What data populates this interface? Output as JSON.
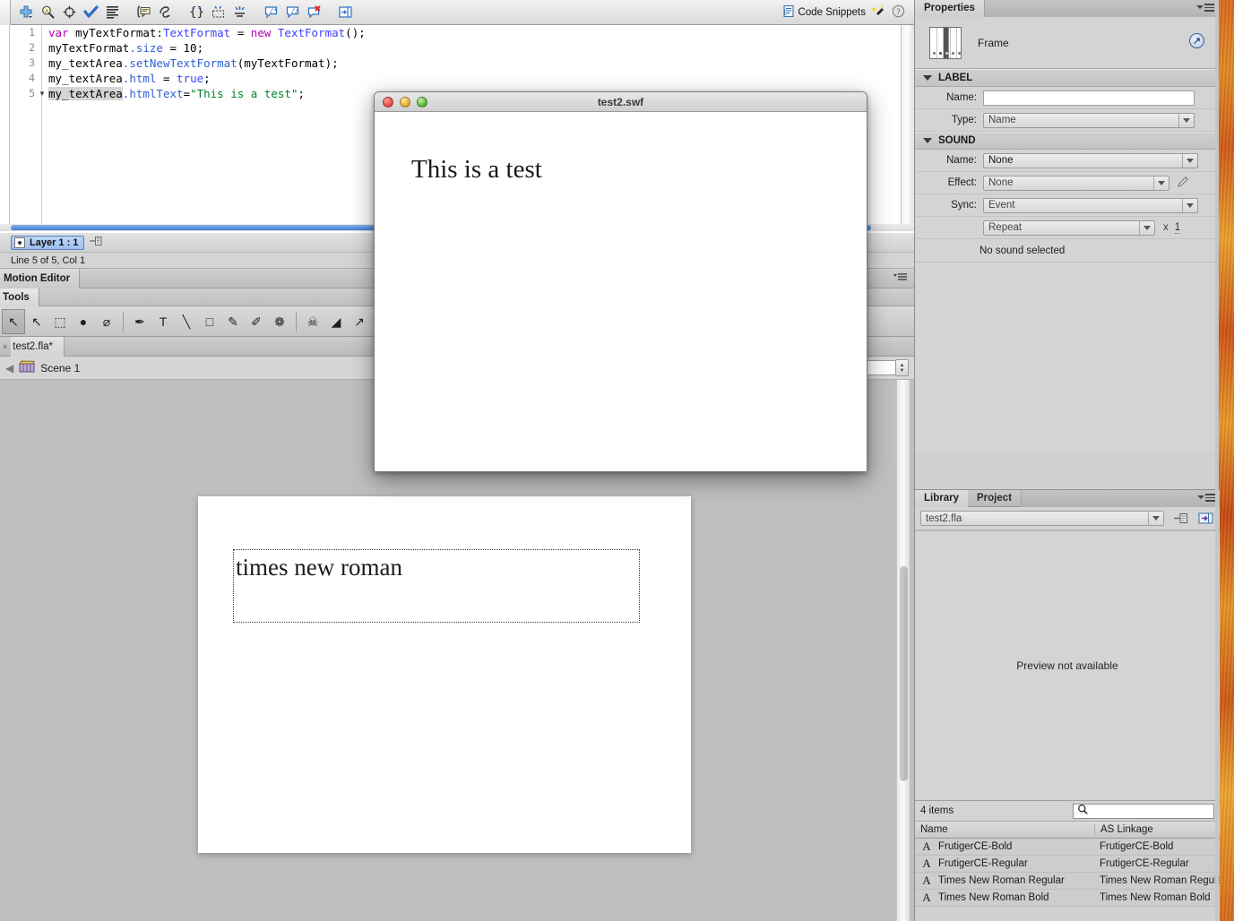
{
  "actions_toolbar": {
    "icons": [
      {
        "name": "add-item-icon",
        "title": "Add statement"
      },
      {
        "name": "find-icon",
        "title": "Find"
      },
      {
        "name": "target-icon",
        "title": "Insert target path"
      },
      {
        "name": "check-syntax-icon",
        "title": "Check syntax"
      },
      {
        "name": "auto-format-icon",
        "title": "Auto format"
      },
      {
        "name": "show-code-hint-icon",
        "title": "Show code hint"
      },
      {
        "name": "debug-options-icon",
        "title": "Debug options"
      },
      {
        "name": "collapse-braces-icon",
        "title": "Collapse between braces"
      },
      {
        "name": "collapse-selection-icon",
        "title": "Collapse selection"
      },
      {
        "name": "expand-all-icon",
        "title": "Expand all"
      },
      {
        "name": "apply-block-comment-icon",
        "title": "Apply block comment"
      },
      {
        "name": "apply-line-comment-icon",
        "title": "Apply line comment"
      },
      {
        "name": "remove-comment-icon",
        "title": "Remove comment"
      },
      {
        "name": "show-hide-toolbox-icon",
        "title": "Show/Hide toolbox"
      }
    ],
    "code_snippets_label": "Code Snippets",
    "wand_icon": "magic-wand-icon",
    "help_icon": "help-icon"
  },
  "code_editor": {
    "line_numbers": [
      "1",
      "2",
      "3",
      "4",
      "5"
    ],
    "fold_markers": [
      "",
      "",
      "",
      "",
      "▼"
    ],
    "lines": [
      [
        {
          "t": "var ",
          "c": "kw"
        },
        {
          "t": "myTextFormat:",
          "c": ""
        },
        {
          "t": "TextFormat",
          "c": "ty"
        },
        {
          "t": " = ",
          "c": ""
        },
        {
          "t": "new",
          "c": "kw"
        },
        {
          "t": " ",
          "c": ""
        },
        {
          "t": "TextFormat",
          "c": "ty"
        },
        {
          "t": "();",
          "c": ""
        }
      ],
      [
        {
          "t": "myTextFormat",
          "c": ""
        },
        {
          "t": ".size",
          "c": "pr"
        },
        {
          "t": " = 10;",
          "c": ""
        }
      ],
      [
        {
          "t": "my_textArea",
          "c": ""
        },
        {
          "t": ".setNewTextFormat",
          "c": "pr"
        },
        {
          "t": "(myTextFormat);",
          "c": ""
        }
      ],
      [
        {
          "t": "my_textArea",
          "c": ""
        },
        {
          "t": ".html",
          "c": "pr"
        },
        {
          "t": " = ",
          "c": ""
        },
        {
          "t": "true",
          "c": "ty"
        },
        {
          "t": ";",
          "c": ""
        }
      ],
      [
        {
          "t": "my_textArea",
          "c": "hl"
        },
        {
          "t": ".htmlText",
          "c": "pr"
        },
        {
          "t": "=",
          "c": ""
        },
        {
          "t": "\"This is a test\"",
          "c": "st"
        },
        {
          "t": ";",
          "c": ""
        }
      ]
    ]
  },
  "timeline": {
    "layer_chip_label": "Layer 1 : 1",
    "pin_icon": "pin-script-icon",
    "status_text": "Line 5 of 5, Col 1"
  },
  "motion_editor": {
    "tab_label": "Motion Editor"
  },
  "tools_panel": {
    "tab_label": "Tools",
    "tools": [
      {
        "name": "selection-tool",
        "glyph": "↖",
        "selected": true
      },
      {
        "name": "subselection-tool",
        "glyph": "↖",
        "selected": false
      },
      {
        "name": "free-transform-tool",
        "glyph": "⬚",
        "selected": false
      },
      {
        "name": "3d-rotation-tool",
        "glyph": "●",
        "selected": false
      },
      {
        "name": "lasso-tool",
        "glyph": "⌀",
        "selected": false
      },
      {
        "name": "pen-tool",
        "glyph": "✒",
        "selected": false
      },
      {
        "name": "text-tool",
        "glyph": "T",
        "selected": false
      },
      {
        "name": "line-tool",
        "glyph": "╲",
        "selected": false
      },
      {
        "name": "rectangle-tool",
        "glyph": "□",
        "selected": false
      },
      {
        "name": "pencil-tool",
        "glyph": "✎",
        "selected": false
      },
      {
        "name": "brush-tool",
        "glyph": "✐",
        "selected": false
      },
      {
        "name": "deco-tool",
        "glyph": "❁",
        "selected": false
      },
      {
        "name": "bone-tool",
        "glyph": "☠",
        "selected": false
      },
      {
        "name": "paint-bucket-tool",
        "glyph": "◢",
        "selected": false
      },
      {
        "name": "eyedropper-tool",
        "glyph": "↗",
        "selected": false
      },
      {
        "name": "eraser-tool",
        "glyph": "▱",
        "selected": false
      }
    ]
  },
  "document_tabs": {
    "close_glyph": "×",
    "tabs": [
      {
        "label": "test2.fla*",
        "active": true
      }
    ]
  },
  "scene_bar": {
    "back_glyph": "◀",
    "scene_icon": "clapperboard-icon",
    "scene_label": "Scene 1",
    "zoom_value": ""
  },
  "stage": {
    "textfield_text": "times new roman"
  },
  "swf_window": {
    "title": "test2.swf",
    "buttons": [
      "close-button",
      "minimize-button",
      "zoom-button"
    ],
    "content_text": "This is a test"
  },
  "properties_panel": {
    "tab_label": "Properties",
    "menu_icon": "panel-menu-icon",
    "thumbnail_icon": "frame-thumbnail-icon",
    "object_type": "Frame",
    "link_icon": "edit-in-new-window-icon",
    "sections": {
      "label": {
        "title": "LABEL",
        "rows": [
          {
            "label": "Name:",
            "value": "",
            "control": "text",
            "disabled": false
          },
          {
            "label": "Type:",
            "value": "Name",
            "control": "combo",
            "disabled": true
          }
        ]
      },
      "sound": {
        "title": "SOUND",
        "rows": [
          {
            "label": "Name:",
            "value": "None",
            "control": "combo",
            "disabled": false
          },
          {
            "label": "Effect:",
            "value": "None",
            "control": "combo",
            "disabled": true,
            "trailing_icon": "pencil-edit-icon"
          },
          {
            "label": "Sync:",
            "value": "Event",
            "control": "combo",
            "disabled": true
          },
          {
            "label": "",
            "value": "Repeat",
            "control": "combo",
            "disabled": true,
            "suffix_x": "x",
            "suffix_count": "1"
          }
        ],
        "status": "No sound selected"
      }
    }
  },
  "library_panel": {
    "tabs": [
      {
        "label": "Library",
        "active": true
      },
      {
        "label": "Project",
        "active": false
      }
    ],
    "menu_icon": "panel-menu-icon",
    "document_selector": "test2.fla",
    "pin_icon": "pin-library-icon",
    "new_library_icon": "new-library-panel-icon",
    "preview_text": "Preview not available",
    "item_count_text": "4 items",
    "search_icon": "search-icon",
    "search_value": "",
    "columns": [
      "Name",
      "AS Linkage"
    ],
    "items": [
      {
        "icon": "font-icon",
        "name": "FrutigerCE-Bold",
        "linkage": "FrutigerCE-Bold"
      },
      {
        "icon": "font-icon",
        "name": "FrutigerCE-Regular",
        "linkage": "FrutigerCE-Regular"
      },
      {
        "icon": "font-icon",
        "name": "Times New Roman Regular",
        "linkage": "Times New Roman Regular"
      },
      {
        "icon": "font-icon",
        "name": "Times New Roman Bold",
        "linkage": "Times New Roman Bold"
      }
    ]
  },
  "colors": {
    "keyword": "#b300b3",
    "type": "#4040ff",
    "property": "#2e5fd4",
    "string": "#00802b",
    "panel_bg": "#d4d4d4",
    "stage_bg": "#bfbfbf",
    "desktop_accent": "#e0701a"
  }
}
